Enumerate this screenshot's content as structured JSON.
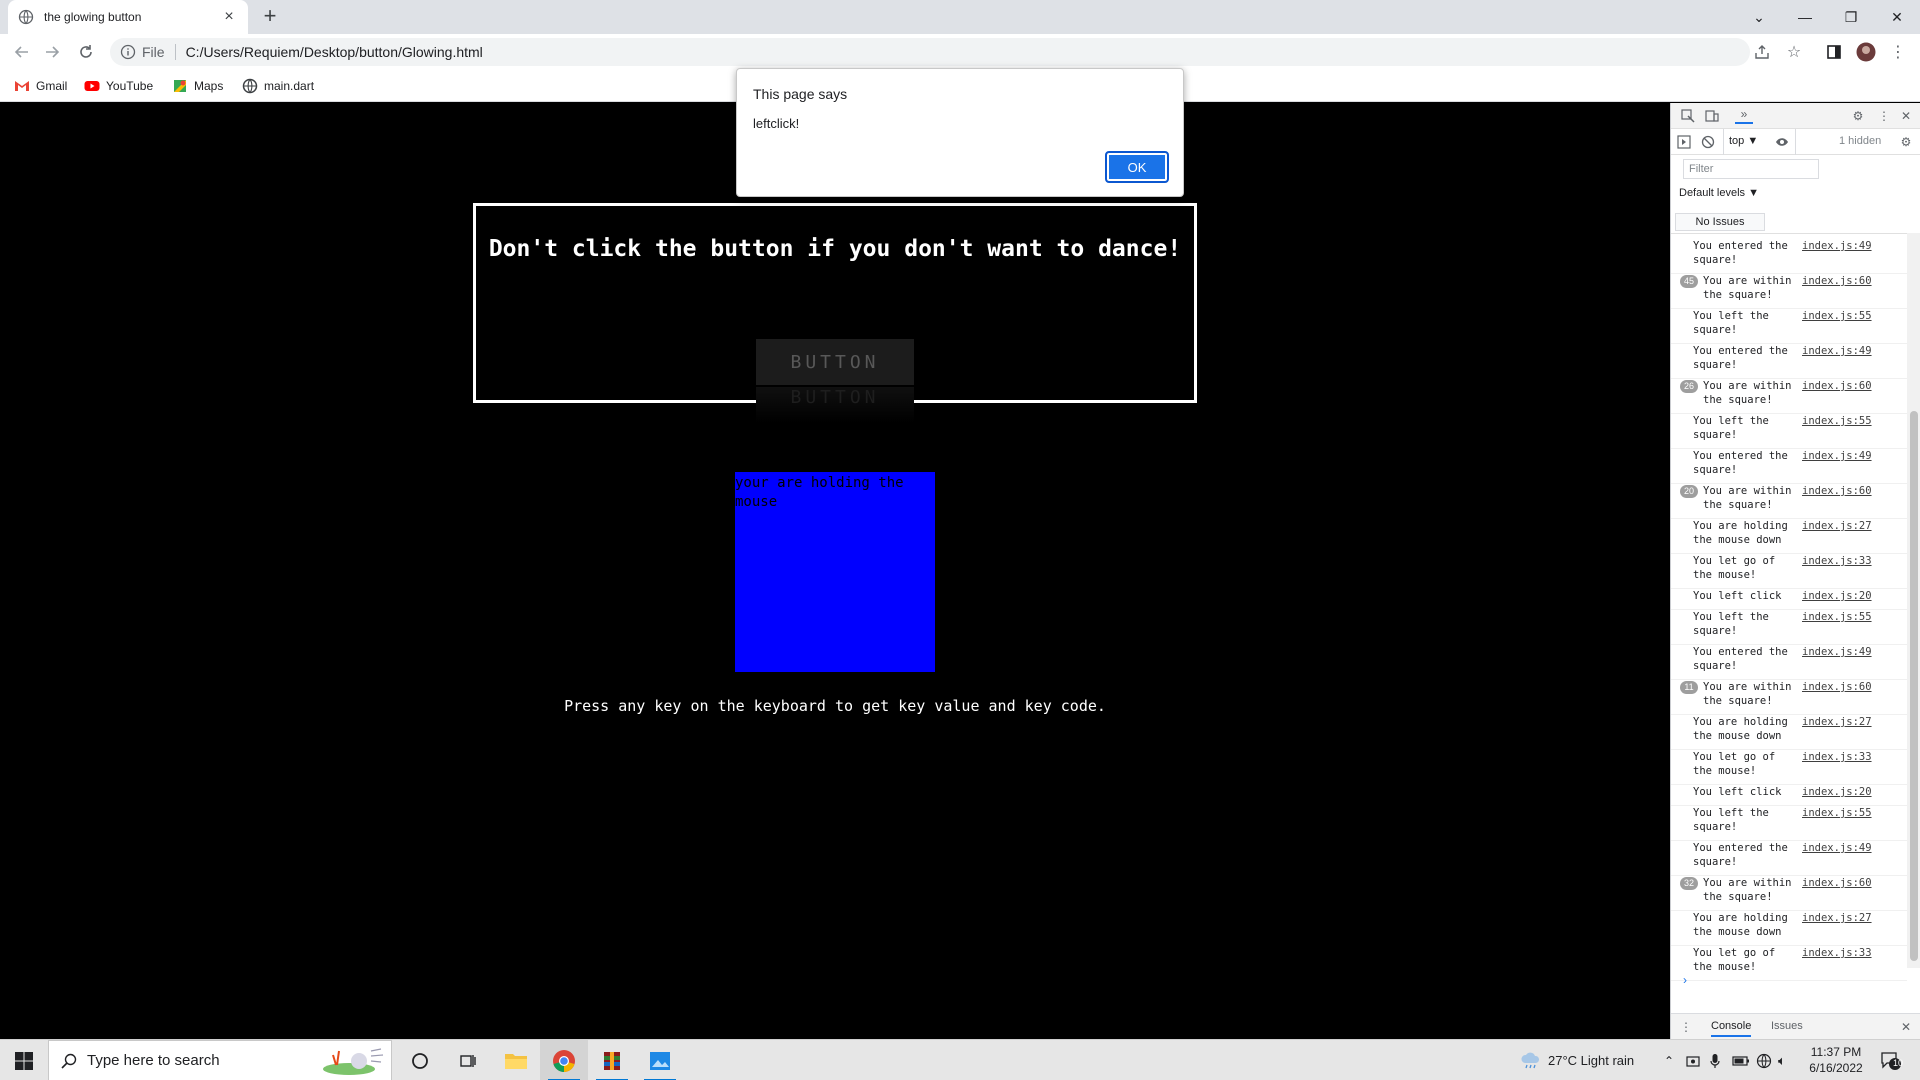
{
  "browser": {
    "tab_title": "the glowing button",
    "tab_close": "×",
    "new_tab": "+",
    "url_scheme": "File",
    "url": "C:/Users/Requiem/Desktop/button/Glowing.html",
    "bookmarks": [
      {
        "label": "Gmail",
        "icon": "gmail-icon"
      },
      {
        "label": "YouTube",
        "icon": "youtube-icon"
      },
      {
        "label": "Maps",
        "icon": "maps-icon"
      },
      {
        "label": "main.dart",
        "icon": "globe-icon"
      }
    ]
  },
  "page": {
    "headline": "Don't click the button if you don't want to dance!",
    "button_label": "BUTTON",
    "square_text": "your are holding the mouse",
    "key_hint": "Press any key on the keyboard to get key value and key code."
  },
  "alert": {
    "title": "This page says",
    "message": "leftclick!",
    "ok_label": "OK"
  },
  "devtools": {
    "context": "top ▼",
    "hidden": "1 hidden",
    "filter_placeholder": "Filter",
    "levels": "Default levels ▼",
    "issues": "No Issues",
    "prompt": "›",
    "bottom_tabs": [
      "Console",
      "Issues"
    ],
    "logs": [
      {
        "count": "",
        "text": "You entered the square!",
        "src": "index.js:49"
      },
      {
        "count": "45",
        "text": "You are within the square!",
        "src": "index.js:60"
      },
      {
        "count": "",
        "text": "You left the square!",
        "src": "index.js:55"
      },
      {
        "count": "",
        "text": "You entered the square!",
        "src": "index.js:49"
      },
      {
        "count": "26",
        "text": "You are within the square!",
        "src": "index.js:60"
      },
      {
        "count": "",
        "text": "You left the square!",
        "src": "index.js:55"
      },
      {
        "count": "",
        "text": "You entered the square!",
        "src": "index.js:49"
      },
      {
        "count": "20",
        "text": "You are within the square!",
        "src": "index.js:60"
      },
      {
        "count": "",
        "text": "You are holding the mouse down",
        "src": "index.js:27"
      },
      {
        "count": "",
        "text": "You let go of the mouse!",
        "src": "index.js:33"
      },
      {
        "count": "",
        "text": "You left click",
        "src": "index.js:20"
      },
      {
        "count": "",
        "text": "You left the square!",
        "src": "index.js:55"
      },
      {
        "count": "",
        "text": "You entered the square!",
        "src": "index.js:49"
      },
      {
        "count": "11",
        "text": "You are within the square!",
        "src": "index.js:60"
      },
      {
        "count": "",
        "text": "You are holding the mouse down",
        "src": "index.js:27"
      },
      {
        "count": "",
        "text": "You let go of the mouse!",
        "src": "index.js:33"
      },
      {
        "count": "",
        "text": "You left click",
        "src": "index.js:20"
      },
      {
        "count": "",
        "text": "You left the square!",
        "src": "index.js:55"
      },
      {
        "count": "",
        "text": "You entered the square!",
        "src": "index.js:49"
      },
      {
        "count": "32",
        "text": "You are within the square!",
        "src": "index.js:60"
      },
      {
        "count": "",
        "text": "You are holding the mouse down",
        "src": "index.js:27"
      },
      {
        "count": "",
        "text": "You let go of the mouse!",
        "src": "index.js:33"
      }
    ]
  },
  "taskbar": {
    "search_placeholder": "Type here to search",
    "weather": "27°C  Light rain",
    "time": "11:37 PM",
    "date": "6/16/2022",
    "notifications": "10"
  },
  "colors": {
    "accent": "#1a73e8",
    "square": "#0000ff",
    "page_bg": "#000000"
  }
}
